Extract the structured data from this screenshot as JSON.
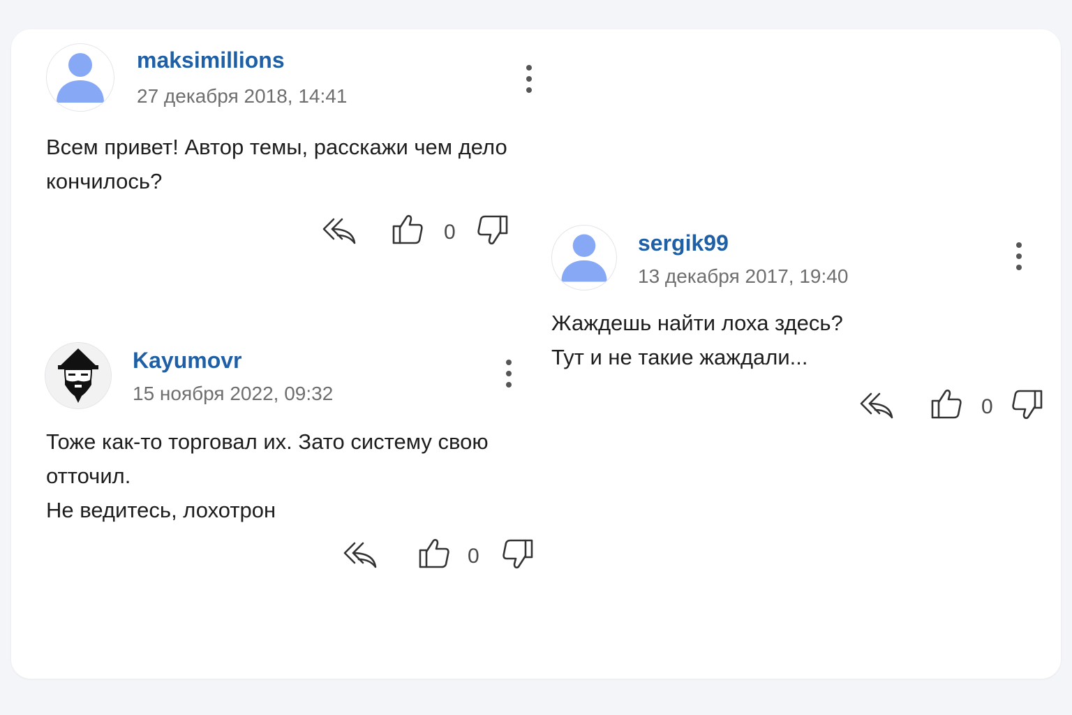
{
  "comments": [
    {
      "username": "maksimillions",
      "date": "27 декабря 2018, 14:41",
      "lines": [
        "Всем привет! Автор темы, расскажи чем дело",
        "кончилось?"
      ],
      "likes": "0",
      "avatar": "default-avatar-icon"
    },
    {
      "username": "sergik99",
      "date": "13 декабря 2017, 19:40",
      "lines": [
        "Жаждешь найти лоха здесь?",
        "Тут и не такие жаждали..."
      ],
      "likes": "0",
      "avatar": "default-avatar-icon"
    },
    {
      "username": "Kayumovr",
      "date": "15 ноября 2022, 09:32",
      "lines": [
        "Тоже как-то торговал их. Зато систему свою",
        "отточил.",
        "Не ведитесь, лохотрон"
      ],
      "likes": "0",
      "avatar": "bearded-man-hat-avatar-icon"
    }
  ],
  "colors": {
    "username": "#1f5fa6",
    "avatar_default": "#86a8f5",
    "text": "#1d1d1d",
    "date": "#6e6e6e"
  },
  "icons": {
    "menu": "more-vertical-icon",
    "reply": "reply-icon",
    "like": "thumbs-up-icon",
    "dislike": "thumbs-down-icon"
  }
}
